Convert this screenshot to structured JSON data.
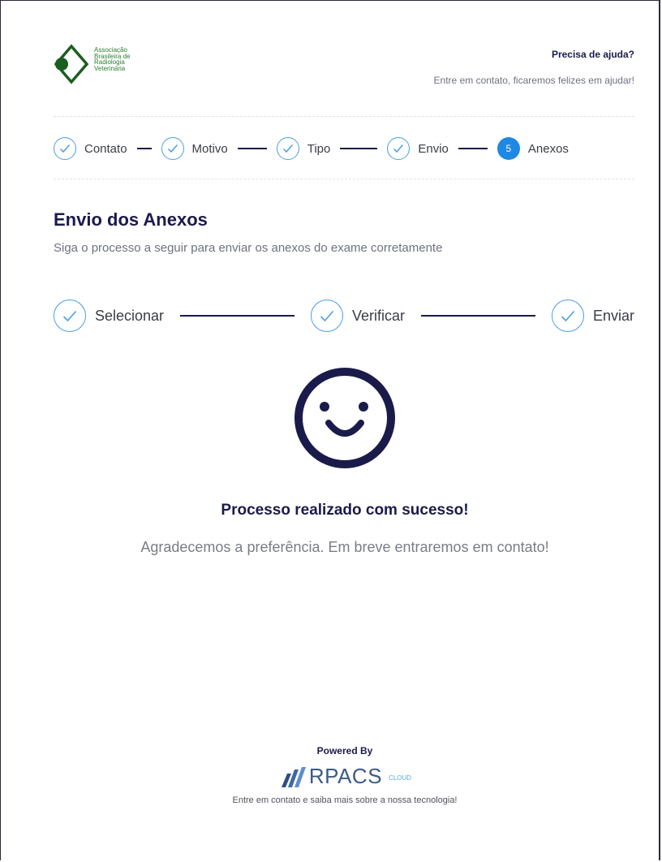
{
  "brand": {
    "logo_lines": [
      "Associação",
      "Brasileira de",
      "Radiologia",
      "Veterinária"
    ]
  },
  "help": {
    "title": "Precisa de ajuda?",
    "subtitle": "Entre em contato, ficaremos felizes em ajudar!"
  },
  "steps": [
    {
      "label": "Contato",
      "state": "done"
    },
    {
      "label": "Motivo",
      "state": "done"
    },
    {
      "label": "Tipo",
      "state": "done"
    },
    {
      "label": "Envio",
      "state": "done"
    },
    {
      "label": "Anexos",
      "state": "current",
      "number": "5"
    }
  ],
  "page": {
    "title": "Envio dos Anexos",
    "subtitle": "Siga o processo a seguir para enviar os anexos do exame corretamente"
  },
  "substeps": [
    {
      "label": "Selecionar",
      "state": "done"
    },
    {
      "label": "Verificar",
      "state": "done"
    },
    {
      "label": "Enviar",
      "state": "done"
    }
  ],
  "result": {
    "icon": "smiley-icon",
    "title": "Processo realizado com sucesso!",
    "message": "Agradecemos a preferência. Em breve entraremos em contato!"
  },
  "footer": {
    "powered_by": "Powered By",
    "brand_name": "RPACS",
    "brand_suffix": "CLOUD",
    "tagline": "Entre em contato e saiba mais sobre a nossa tecnologia!"
  },
  "colors": {
    "primary": "#1a1b4b",
    "accent": "#1e88e5",
    "check": "#4a9ee8",
    "logo_green": "#2e7d32",
    "muted": "#6d7280"
  }
}
